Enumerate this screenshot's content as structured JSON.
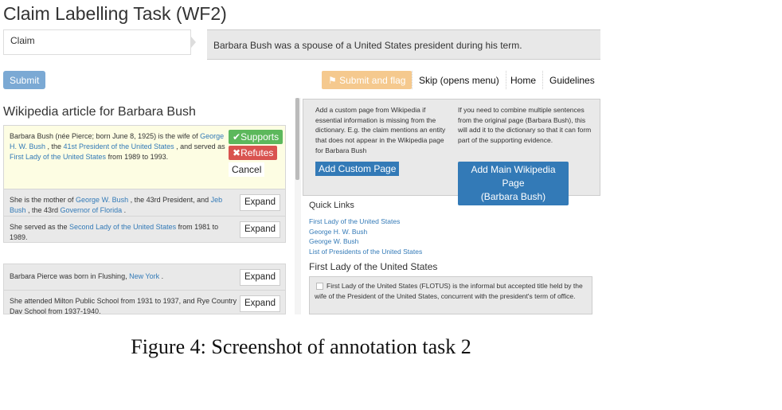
{
  "header": {
    "title": "Claim Labelling Task (WF2)",
    "claim_label": "Claim",
    "claim_text": "Barbara Bush was a spouse of a United States president during his term."
  },
  "toolbar": {
    "submit": "Submit",
    "submit_flag": "Submit and flag",
    "skip": "Skip (opens menu)",
    "home": "Home",
    "guidelines": "Guidelines"
  },
  "article": {
    "title": "Wikipedia article for Barbara Bush",
    "sentences": [
      {
        "segments": [
          {
            "t": "Barbara Bush (née Pierce; born June 8, 1925) is the wife of "
          },
          {
            "t": "George H. W. Bush",
            "link": true
          },
          {
            "t": " , the "
          },
          {
            "t": "41st President of the United States",
            "link": true
          },
          {
            "t": " , and served as "
          },
          {
            "t": "First Lady of the United States",
            "link": true
          },
          {
            "t": " from 1989 to 1993."
          }
        ]
      },
      {
        "segments": [
          {
            "t": "She is the mother of "
          },
          {
            "t": "George W. Bush",
            "link": true
          },
          {
            "t": " , the 43rd President, and "
          },
          {
            "t": "Jeb Bush",
            "link": true
          },
          {
            "t": " , the 43rd "
          },
          {
            "t": "Governor of Florida",
            "link": true
          },
          {
            "t": " ."
          }
        ]
      },
      {
        "segments": [
          {
            "t": "She served as the "
          },
          {
            "t": "Second Lady of the United States",
            "link": true
          },
          {
            "t": " from 1981 to 1989."
          }
        ]
      },
      {
        "segments": [
          {
            "t": "Barbara Pierce was born in Flushing, "
          },
          {
            "t": "New York",
            "link": true
          },
          {
            "t": " ."
          }
        ]
      },
      {
        "segments": [
          {
            "t": "She attended Milton Public School from 1931 to 1937, and Rye Country Day School from 1937-1940."
          }
        ]
      }
    ],
    "supports": "Supports",
    "refutes": "Refutes",
    "cancel": "Cancel",
    "expand": "Expand"
  },
  "side": {
    "custom_info": "Add a custom page from Wikipedia if essential information is missing from the dictionary. E.g. the claim mentions an entity that does not appear in the Wikipedia page for Barbara Bush",
    "main_info": "If you need to combine multiple sentences from the original page (Barbara Bush), this will add it to the dictionary so that it can form part of the supporting evidence.",
    "custom_btn": "Add Custom Page",
    "main_btn_1": "Add Main Wikipedia Page",
    "main_btn_2": "(Barbara Bush)",
    "quick_links_title": "Quick Links",
    "quick_links": [
      "First Lady of the United States",
      "George H. W. Bush",
      "George W. Bush",
      "List of Presidents of the United States"
    ],
    "section_title": "First Lady of the United States",
    "evidence": "First Lady of the United States (FLOTUS) is the informal but accepted title held by the wife of the President of the United States, concurrent with the president's term of office."
  },
  "caption": "Figure 4: Screenshot of annotation task 2"
}
